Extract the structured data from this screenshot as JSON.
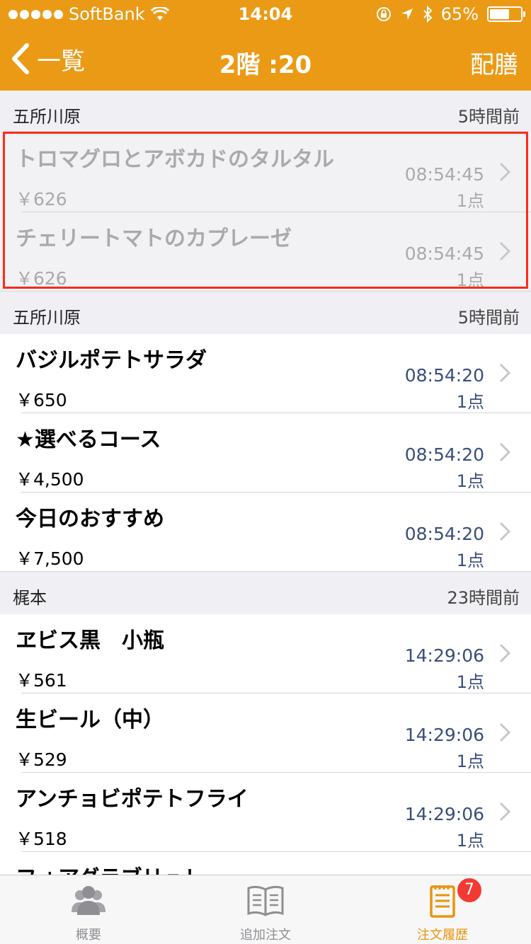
{
  "status_bar": {
    "carrier": "SoftBank",
    "time": "14:04",
    "battery": "65%",
    "battery_level": 0.65
  },
  "nav": {
    "back_label": "一覧",
    "title": "2階 :20",
    "right_label": "配膳"
  },
  "sections": [
    {
      "name": "五所川原",
      "ago": "5時間前",
      "items": [
        {
          "name": "トロマグロとアボカドのタルタル",
          "price": "￥626",
          "time": "08:54:45",
          "qty": "1点"
        },
        {
          "name": "チェリートマトのカプレーゼ",
          "price": "￥626",
          "time": "08:54:45",
          "qty": "1点"
        }
      ]
    },
    {
      "name": "五所川原",
      "ago": "5時間前",
      "items": [
        {
          "name": "バジルポテトサラダ",
          "price": "￥650",
          "time": "08:54:20",
          "qty": "1点"
        },
        {
          "name": "★選べるコース",
          "price": "￥4,500",
          "time": "08:54:20",
          "qty": "1点"
        },
        {
          "name": "今日のおすすめ",
          "price": "￥7,500",
          "time": "08:54:20",
          "qty": "1点"
        }
      ]
    },
    {
      "name": "梶本",
      "ago": "23時間前",
      "items": [
        {
          "name": "ヱビス黒　小瓶",
          "price": "￥561",
          "time": "14:29:06",
          "qty": "1点"
        },
        {
          "name": "生ビール（中）",
          "price": "￥529",
          "time": "14:29:06",
          "qty": "1点"
        },
        {
          "name": "アンチョビポテトフライ",
          "price": "￥518",
          "time": "14:29:06",
          "qty": "1点"
        },
        {
          "name": "フォアグラブリュレ",
          "price": "",
          "time": "",
          "qty": ""
        }
      ]
    }
  ],
  "tabs": [
    {
      "label": "概要",
      "icon": "people-icon"
    },
    {
      "label": "追加注文",
      "icon": "book-icon"
    },
    {
      "label": "注文履歴",
      "icon": "notepad-icon"
    }
  ],
  "badge": "7",
  "colors": {
    "accent": "#eb9a16",
    "time_text": "#3a4e7a",
    "highlight": "#ff2a1a",
    "badge": "#f23a33"
  }
}
